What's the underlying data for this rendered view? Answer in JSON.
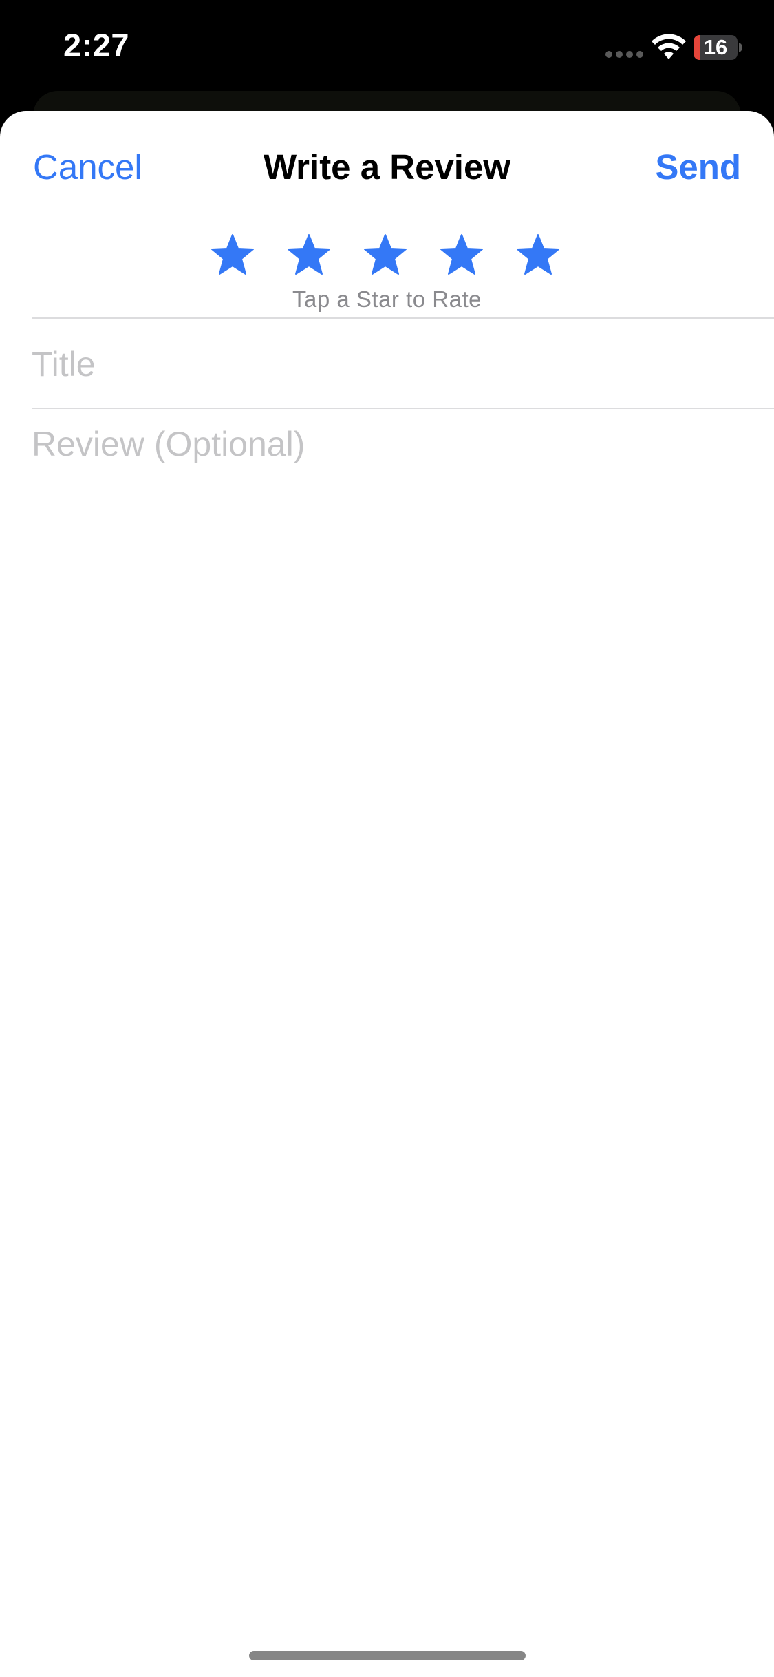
{
  "status_bar": {
    "time": "2:27",
    "battery_level": "16",
    "battery_fraction": 0.16,
    "signal_icon": "signal-dots-icon",
    "wifi_icon": "wifi-icon",
    "battery_icon": "battery-icon"
  },
  "sheet": {
    "cancel_label": "Cancel",
    "title": "Write a Review",
    "send_label": "Send"
  },
  "rating": {
    "stars": [
      {
        "icon": "star-icon",
        "filled": true
      },
      {
        "icon": "star-icon",
        "filled": true
      },
      {
        "icon": "star-icon",
        "filled": true
      },
      {
        "icon": "star-icon",
        "filled": true
      },
      {
        "icon": "star-icon",
        "filled": true
      }
    ],
    "hint": "Tap a Star to Rate"
  },
  "form": {
    "title_value": "",
    "title_placeholder": "Title",
    "review_value": "",
    "review_placeholder": "Review (Optional)"
  },
  "colors": {
    "accent": "#3478f6",
    "battery_low": "#e5453a",
    "placeholder": "#c4c4c6",
    "hint": "#8a8a8e"
  }
}
